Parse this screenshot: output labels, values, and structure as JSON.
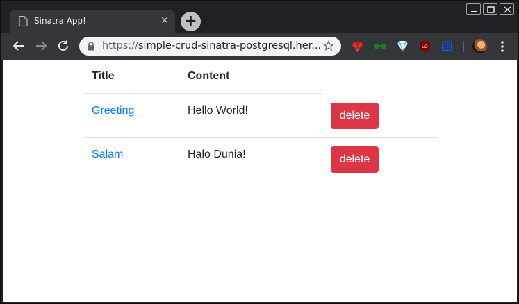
{
  "browser": {
    "tab_title": "Sinatra App!",
    "url_scheme": "https://",
    "url_rest": "simple-crud-sinatra-postgresql.her..."
  },
  "table": {
    "headers": [
      "Title",
      "Content"
    ],
    "rows": [
      {
        "title": "Greeting",
        "content": "Hello World!",
        "action": "delete"
      },
      {
        "title": "Salam",
        "content": "Halo Dunia!",
        "action": "delete"
      }
    ]
  },
  "colors": {
    "link": "#007bff",
    "danger": "#dc3545",
    "chrome_dark": "#202124",
    "toolbar": "#35363a"
  }
}
